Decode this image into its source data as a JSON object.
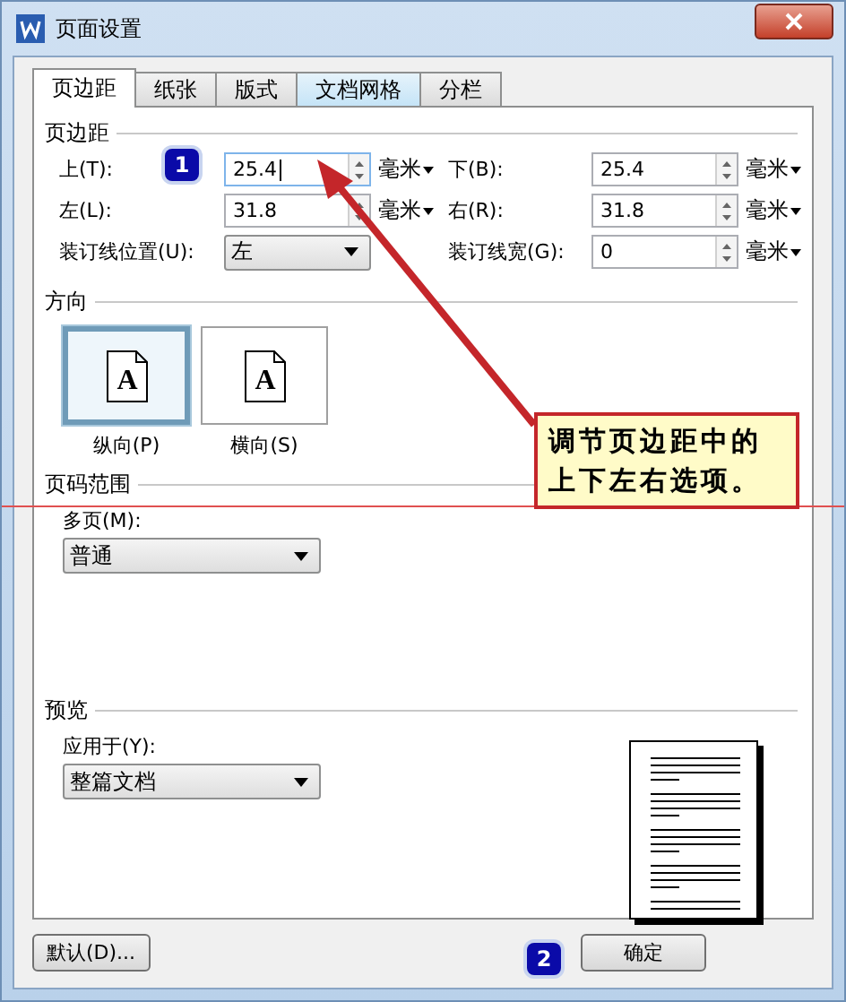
{
  "window": {
    "title": "页面设置"
  },
  "tabs": [
    {
      "label": "页边距",
      "selected": true
    },
    {
      "label": "纸张",
      "selected": false
    },
    {
      "label": "版式",
      "selected": false
    },
    {
      "label": "文档网格",
      "selected": false
    },
    {
      "label": "分栏",
      "selected": false
    }
  ],
  "margins": {
    "title": "页边距",
    "rows": [
      [
        {
          "label": "上(T):",
          "value": "25.4",
          "unit": "毫米",
          "focused": true
        },
        {
          "label": "下(B):",
          "value": "25.4",
          "unit": "毫米",
          "focused": false
        }
      ],
      [
        {
          "label": "左(L):",
          "value": "31.8",
          "unit": "毫米",
          "focused": false
        },
        {
          "label": "右(R):",
          "value": "31.8",
          "unit": "毫米",
          "focused": false
        }
      ]
    ],
    "gutter_position": {
      "label": "装订线位置(U):",
      "value": "左"
    },
    "gutter_width": {
      "label": "装订线宽(G):",
      "value": "0",
      "unit": "毫米"
    }
  },
  "orientation": {
    "title": "方向",
    "options": [
      {
        "label": "纵向(P)",
        "glyph": "A",
        "selected": true
      },
      {
        "label": "横向(S)",
        "glyph": "A",
        "selected": false
      }
    ]
  },
  "page_range": {
    "title": "页码范围",
    "label": "多页(M):",
    "value": "普通"
  },
  "preview": {
    "title": "预览",
    "label": "应用于(Y):",
    "value": "整篇文档"
  },
  "buttons": [
    {
      "label": "默认(D)..."
    },
    {
      "label": "确定"
    }
  ],
  "annotations": {
    "badges": [
      "1",
      "2"
    ],
    "callout": "调节页边距中的上下左右选项。"
  }
}
